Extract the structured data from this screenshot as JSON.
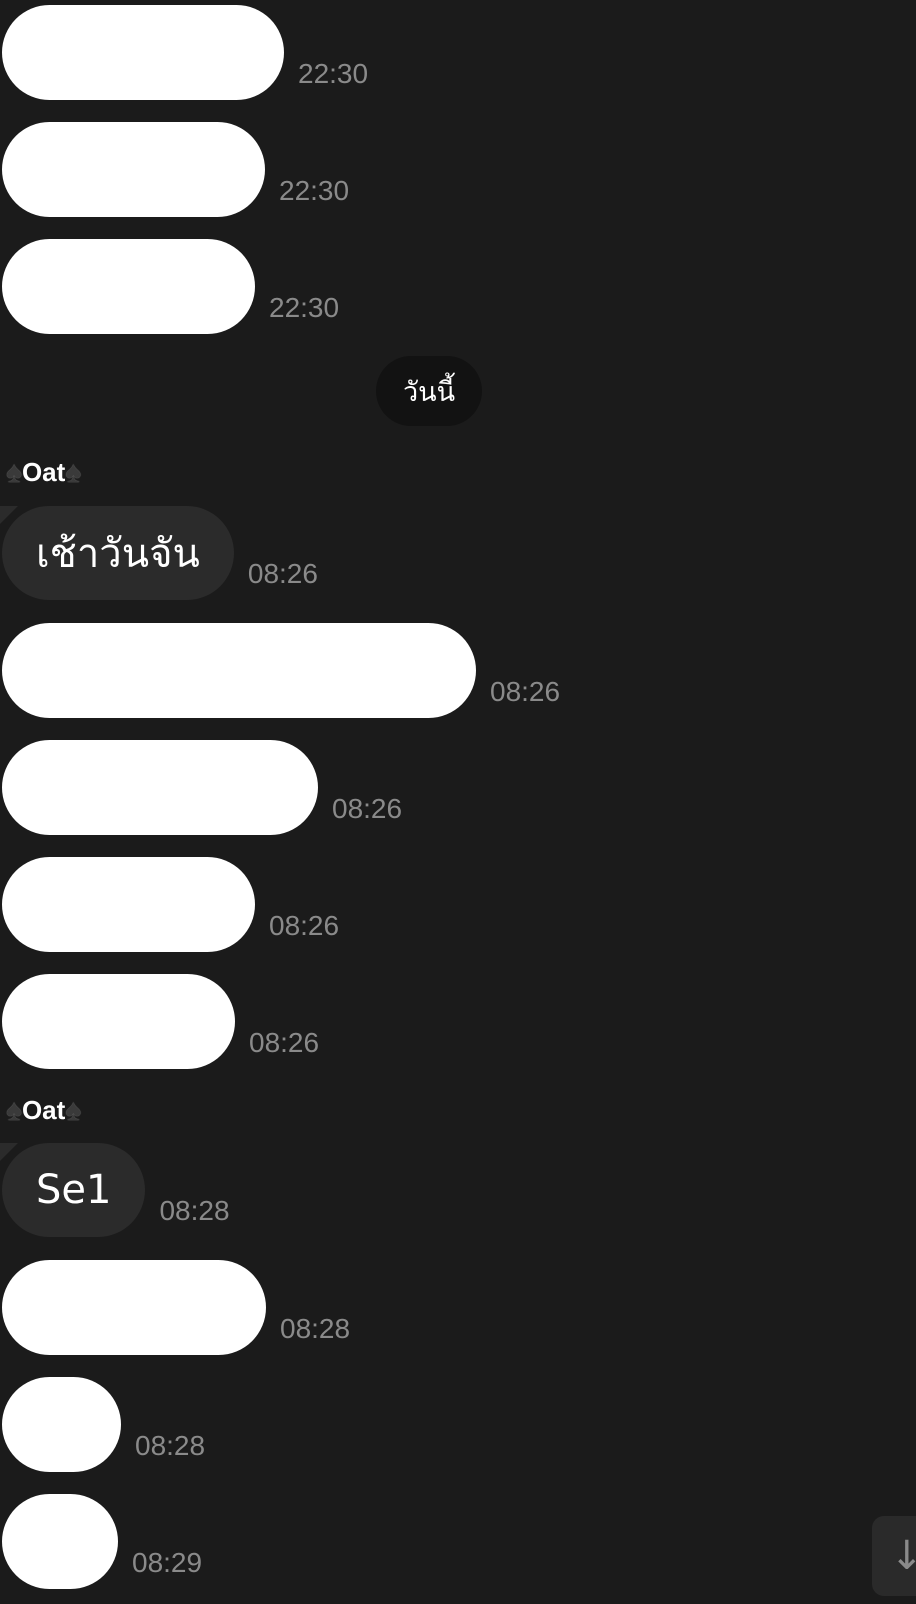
{
  "messages": [
    {
      "type": "redacted",
      "time": "22:30"
    },
    {
      "type": "redacted",
      "time": "22:30"
    },
    {
      "type": "redacted",
      "time": "22:30"
    },
    {
      "type": "text",
      "text": "เช้าวันจัน",
      "time": "08:26"
    },
    {
      "type": "redacted",
      "time": "08:26"
    },
    {
      "type": "redacted",
      "time": "08:26"
    },
    {
      "type": "redacted",
      "time": "08:26"
    },
    {
      "type": "redacted",
      "time": "08:26"
    },
    {
      "type": "text",
      "text": "Se1",
      "time": "08:28"
    },
    {
      "type": "redacted",
      "time": "08:28"
    },
    {
      "type": "redacted",
      "time": "08:28"
    },
    {
      "type": "redacted",
      "time": "08:29"
    }
  ],
  "date_divider": "วันนี้",
  "sender_name": "Oat",
  "sender_suit": "♠",
  "scroll_icon": "arrow-down-icon",
  "scroll_glyph": "↓",
  "colors": {
    "background": "#1b1b1b",
    "incoming_bubble": "#2b2b2b",
    "redacted_bubble": "#ffffff",
    "timestamp": "#8a8a8a"
  }
}
